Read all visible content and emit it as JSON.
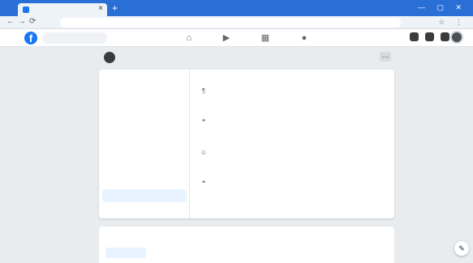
{
  "browser": {
    "tab_title": "",
    "tab_close_glyph": "×",
    "new_tab_glyph": "+",
    "window_controls": "—  ▢  ✕",
    "address": "",
    "nav": {
      "back": "←",
      "forward": "→",
      "reload": "⟳"
    },
    "toolbar_icons": "☆ ⋮"
  },
  "facebook": {
    "logo_letter": "f",
    "search_placeholder": "",
    "nav_icons": [
      "home-icon",
      "watch-icon",
      "marketplace-icon",
      "groups-icon"
    ],
    "nav_glyphs": [
      "⌂",
      "▶",
      "▦",
      "●"
    ],
    "right_icons": [
      "menu-icon",
      "messenger-icon",
      "notifications-icon"
    ]
  },
  "profile": {
    "name": "",
    "more_glyph": "…"
  },
  "about": {
    "sidebar_title": "",
    "sidebar_items": [
      {
        "label": "",
        "active": false
      },
      {
        "label": "",
        "active": false
      },
      {
        "label": "",
        "active": false
      },
      {
        "label": "",
        "active": false
      },
      {
        "label": "",
        "active": false
      },
      {
        "label": "",
        "active": false
      },
      {
        "label": "",
        "active": false
      },
      {
        "label": "",
        "active": true
      },
      {
        "label": "",
        "active": false
      }
    ],
    "sections": [
      {
        "title": "",
        "icon_glyph": "¶",
        "icon_name": "paragraph-icon",
        "text": ""
      },
      {
        "title": "",
        "icon_glyph": "❝",
        "icon_name": "quote-icon",
        "text": ""
      },
      {
        "title": "",
        "icon_glyph": "☺",
        "icon_name": "person-icon",
        "text": ""
      },
      {
        "title": "",
        "icon_glyph": "❝",
        "icon_name": "quote-icon",
        "text": ""
      }
    ]
  },
  "lower_card": {
    "title": "",
    "link_label": ""
  },
  "chat_glyph": "✎"
}
